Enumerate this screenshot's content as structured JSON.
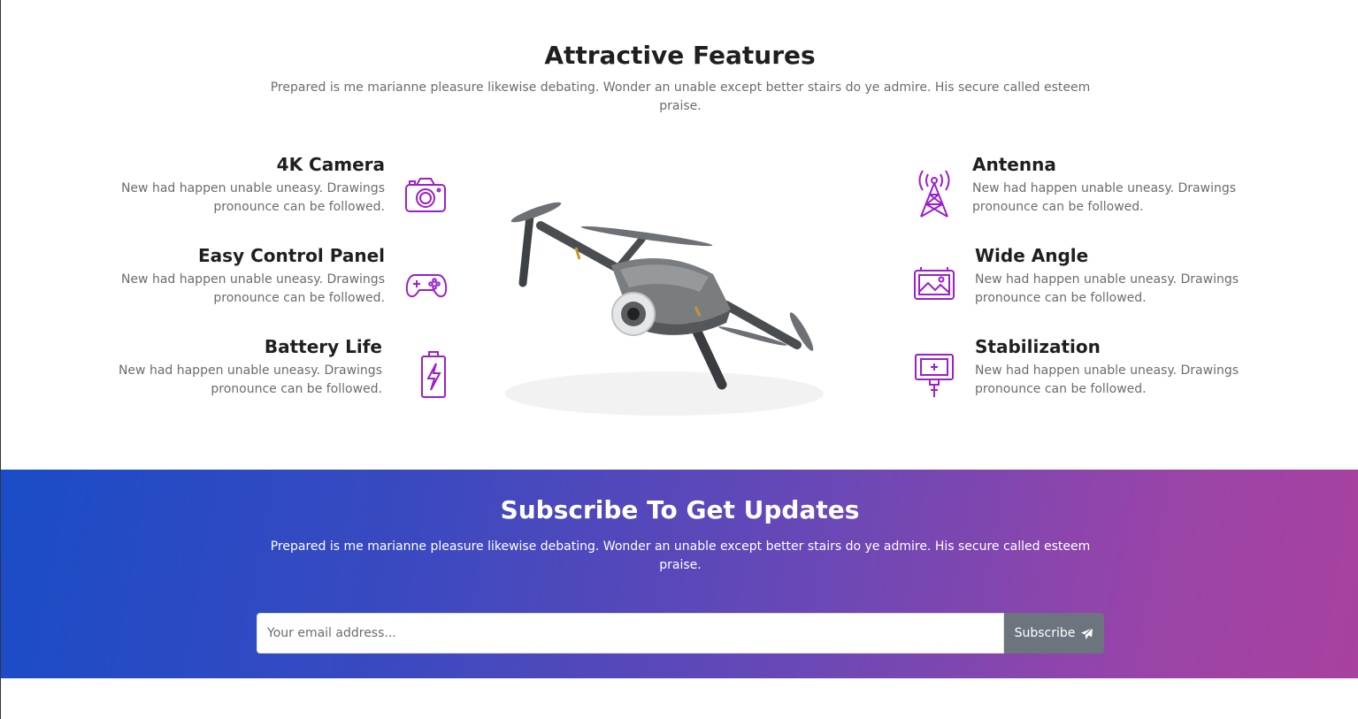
{
  "features": {
    "title": "Attractive Features",
    "intro": "Prepared is me marianne pleasure likewise debating. Wonder an unable except better stairs do ye admire. His secure called esteem praise.",
    "left": [
      {
        "title": "4K Camera",
        "text": "New had happen unable uneasy. Drawings pronounce can be followed.",
        "icon": "camera-icon"
      },
      {
        "title": "Easy Control Panel",
        "text": "New had happen unable uneasy. Drawings pronounce can be followed.",
        "icon": "gamepad-icon"
      },
      {
        "title": "Battery Life",
        "text": "New had happen unable uneasy. Drawings pronounce can be followed.",
        "icon": "battery-icon"
      }
    ],
    "right": [
      {
        "title": "Antenna",
        "text": "New had happen unable uneasy. Drawings pronounce can be followed.",
        "icon": "antenna-icon"
      },
      {
        "title": "Wide Angle",
        "text": "New had happen unable uneasy. Drawings pronounce can be followed.",
        "icon": "wide-angle-icon"
      },
      {
        "title": "Stabilization",
        "text": "New had happen unable uneasy. Drawings pronounce can be followed.",
        "icon": "stabilizer-icon"
      }
    ],
    "icon_color": "#9c1fc9"
  },
  "subscribe": {
    "title": "Subscribe To Get Updates",
    "intro": "Prepared is me marianne pleasure likewise debating. Wonder an unable except better stairs do ye admire. His secure called esteem praise.",
    "email_placeholder": "Your email address...",
    "button_label": "Subscribe",
    "button_icon": "paper-plane-icon",
    "gradient_start": "#1a4cc7",
    "gradient_end": "#a8419f"
  }
}
